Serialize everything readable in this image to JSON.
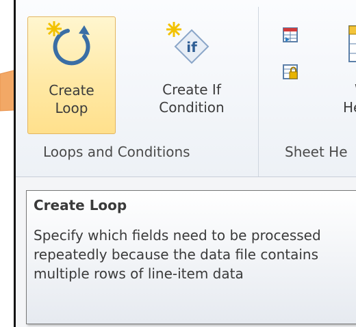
{
  "ribbon": {
    "create_loop_label_line1": "Create",
    "create_loop_label_line2": "Loop",
    "create_if_label_line1": "Create If",
    "create_if_label_line2": "Condition",
    "partial_button_label_line1": "W",
    "partial_button_label_line2": "He",
    "if_icon_text": "if",
    "loops_group_label": "Loops and Conditions",
    "sheet_group_label": "Sheet He"
  },
  "tooltip": {
    "title": "Create Loop",
    "body": "Specify which fields need to be processed repeatedly because the data file contains multiple rows of line-item data"
  },
  "colors": {
    "accent_active": "#ffe9a6",
    "pointer": "#f2a866",
    "loop_icon": "#3a6ea5"
  }
}
